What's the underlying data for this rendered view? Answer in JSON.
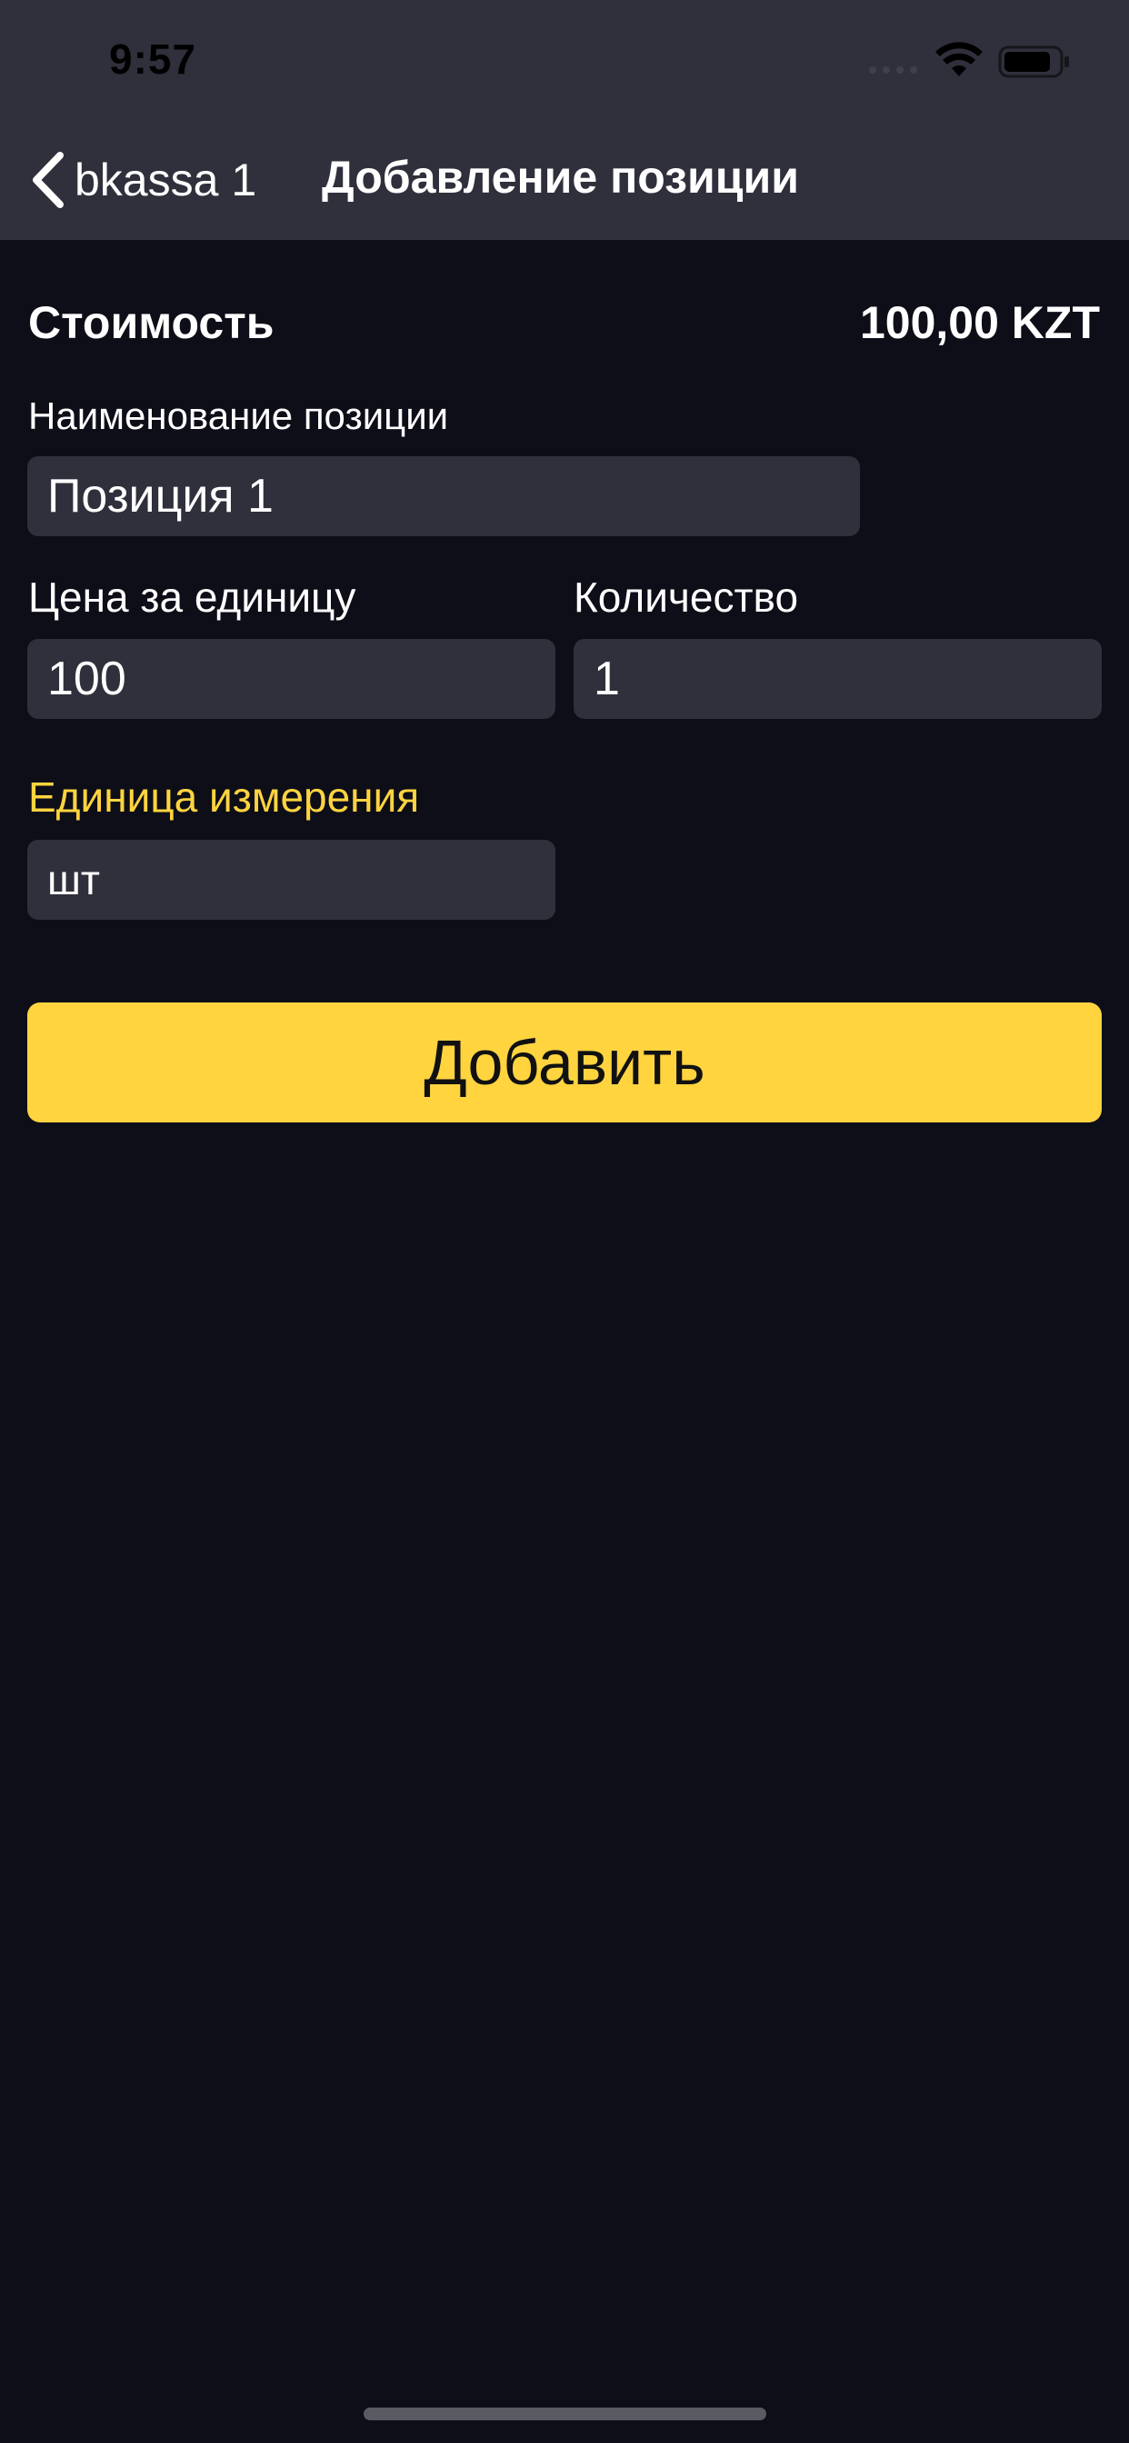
{
  "status_bar": {
    "time": "9:57"
  },
  "nav": {
    "back_label": "bkassa 1",
    "title": "Добавление позиции"
  },
  "summary": {
    "cost_label": "Стоимость",
    "cost_value": "100,00 KZT"
  },
  "form": {
    "name_label": "Наименование позиции",
    "name_value": "Позиция 1",
    "price_label": "Цена за единицу",
    "price_value": "100",
    "quantity_label": "Количество",
    "quantity_value": "1",
    "unit_label": "Единица измерения",
    "unit_value": "шт"
  },
  "actions": {
    "add_label": "Добавить"
  },
  "colors": {
    "background": "#0e0e18",
    "header": "#2f303b",
    "field": "#2f303b",
    "accent": "#ffd43f",
    "text": "#ffffff"
  },
  "icons": [
    "chevron-left-icon",
    "signal-icon",
    "wifi-icon",
    "battery-icon"
  ]
}
